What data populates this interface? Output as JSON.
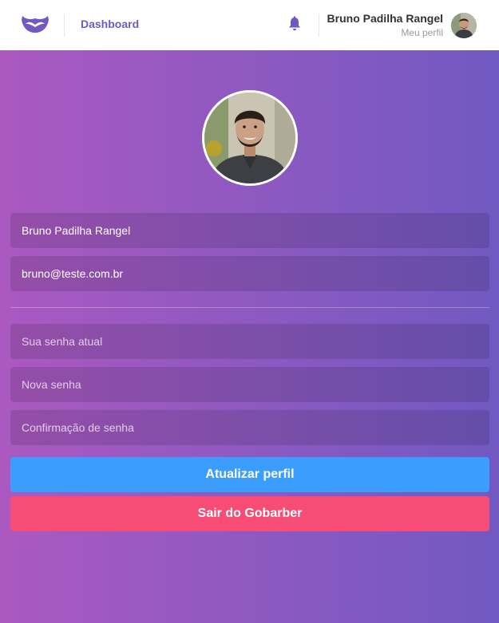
{
  "header": {
    "nav_link": "Dashboard",
    "user_name": "Bruno Padilha Rangel",
    "profile_link": "Meu perfil"
  },
  "profile_form": {
    "name_value": "Bruno Padilha Rangel",
    "email_value": "bruno@teste.com.br",
    "current_password_placeholder": "Sua senha atual",
    "new_password_placeholder": "Nova senha",
    "confirm_password_placeholder": "Confirmação de senha",
    "update_button": "Atualizar perfil",
    "logout_button": "Sair do Gobarber"
  },
  "icons": {
    "logo": "mustache-logo-icon",
    "notifications": "bell-icon"
  },
  "colors": {
    "accent": "#7159c1",
    "gradient_start": "#ab59c1",
    "gradient_end": "#7159c1",
    "primary_button": "#3b9eff",
    "danger_button": "#f64c75"
  }
}
